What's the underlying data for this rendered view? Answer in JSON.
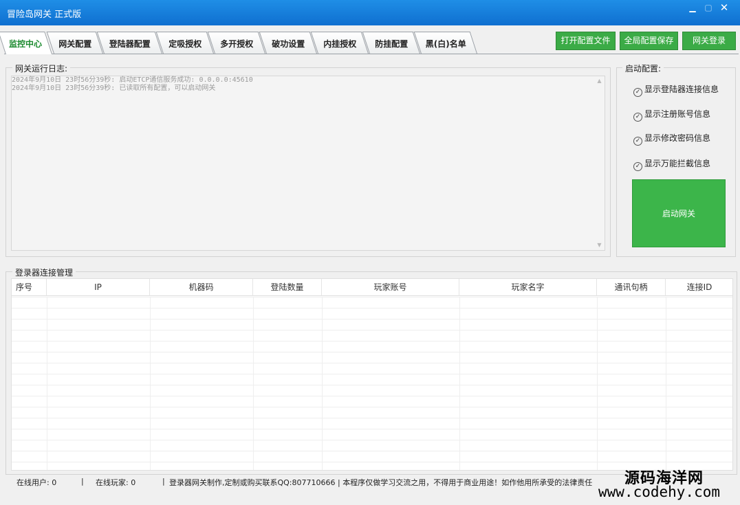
{
  "window": {
    "title": "冒险岛网关 正式版",
    "min": "▁",
    "max": "▢",
    "close": "✕"
  },
  "tabs": [
    {
      "label": "监控中心",
      "active": true
    },
    {
      "label": "网关配置"
    },
    {
      "label": "登陆器配置"
    },
    {
      "label": "定吸授权"
    },
    {
      "label": "多开授权"
    },
    {
      "label": "破功设置"
    },
    {
      "label": "内挂授权"
    },
    {
      "label": "防挂配置"
    },
    {
      "label": "黑(白)名单"
    }
  ],
  "toolbar": {
    "open_config": "打开配置文件",
    "save_global": "全局配置保存",
    "gateway_login": "网关登录"
  },
  "log": {
    "title": "网关运行日志:",
    "lines": [
      "2024年9月10日 23时56分39秒: 启动ETCP通信服务成功: 0.0.0.0:45610",
      "2024年9月10日 23时56分39秒: 已读取所有配置，可以启动网关"
    ]
  },
  "startup": {
    "title": "启动配置:",
    "options": [
      "显示登陆器连接信息",
      "显示注册账号信息",
      "显示修改密码信息",
      "显示万能拦截信息"
    ],
    "check_glyph": "✓",
    "start_button": "启动网关"
  },
  "connections": {
    "title": "登录器连接管理",
    "columns": [
      "序号",
      "IP",
      "机器码",
      "登陆数量",
      "玩家账号",
      "玩家名字",
      "通讯句柄",
      "连接ID"
    ],
    "rows": []
  },
  "status": {
    "online_users": "在线用户: 0",
    "online_players": "在线玩家: 0",
    "sep": "|",
    "notice": "登录器网关制作,定制或购买联系QQ:807710666 | 本程序仅做学习交流之用，不得用于商业用途！如作他用所承受的法律责任"
  },
  "watermark": {
    "name": "源码海洋网",
    "url": "www.codehy.com"
  },
  "colors": {
    "titlebar": "#1a82dc",
    "accent_green": "#3bab46",
    "active_tab_text": "#1b8a2e"
  }
}
